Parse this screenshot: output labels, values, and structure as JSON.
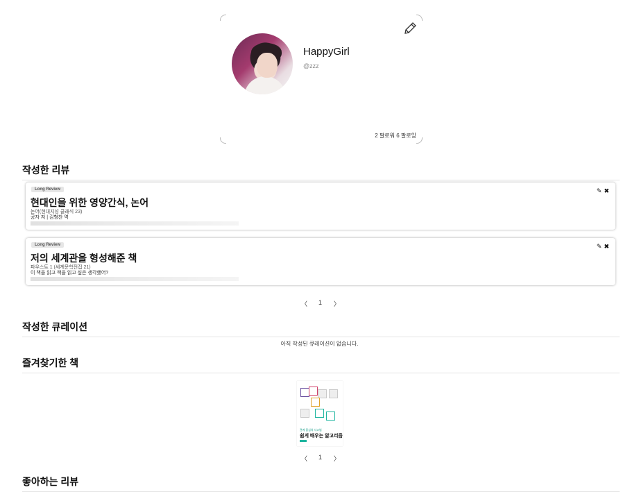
{
  "profile": {
    "nickname": "HappyGirl",
    "handle": "@zzz",
    "follow_text": "2 팔로워 6 팔로잉",
    "edit_icon": "pencil-icon"
  },
  "sections": {
    "my_reviews": "작성한 리뷰",
    "my_curations": "작성한 큐레이션",
    "bookmarked_books": "즐겨찾기한 책",
    "liked_reviews": "좋아하는 리뷰"
  },
  "reviews": [
    {
      "badge": "Long Review",
      "title": "현대인을 위한 영양간식, 논어",
      "book": "논어(현대지성 클래식 23)",
      "author": "공자 저 | 김형찬 역"
    },
    {
      "badge": "Long Review",
      "title": "저의 세계관을 형성해준 책",
      "book": "파우스트 1 (세계문학전집 21)",
      "excerpt": "이 책을 읽고 책을 읽고 싶은 생각했어?"
    }
  ],
  "review_actions": {
    "edit": "✎",
    "delete": "✖"
  },
  "pager": {
    "prev": "〈",
    "page": "1",
    "next": "〉"
  },
  "curations_empty": "아직 작성된 큐레이션이 없습니다.",
  "bookmarked_book": {
    "title": "쉽게 배우는 알고리즘",
    "subtitle": "관계 중심의 사고법"
  }
}
